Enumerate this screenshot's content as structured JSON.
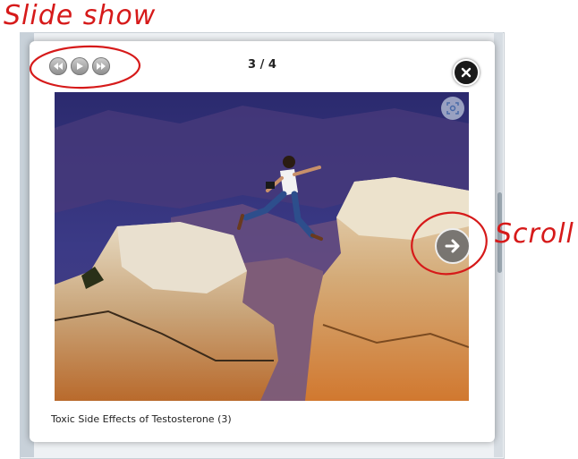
{
  "annotations": {
    "slideshow_label": "Slide show",
    "scroll_label": "Scroll"
  },
  "lightbox": {
    "counter": "3 / 4",
    "caption": "Toxic Side Effects of Testosterone (3)",
    "controls": [
      {
        "name": "previous",
        "icon": "rewind-icon"
      },
      {
        "name": "play",
        "icon": "play-icon"
      },
      {
        "name": "next",
        "icon": "fast-forward-icon"
      }
    ],
    "close_icon": "close-icon",
    "zoom_icon": "zoom-icon",
    "next_icon": "arrow-right-icon"
  },
  "colors": {
    "annotation": "#d61a1a",
    "control_button": "#9a9a9a",
    "close_button": "#1a1a1a"
  }
}
